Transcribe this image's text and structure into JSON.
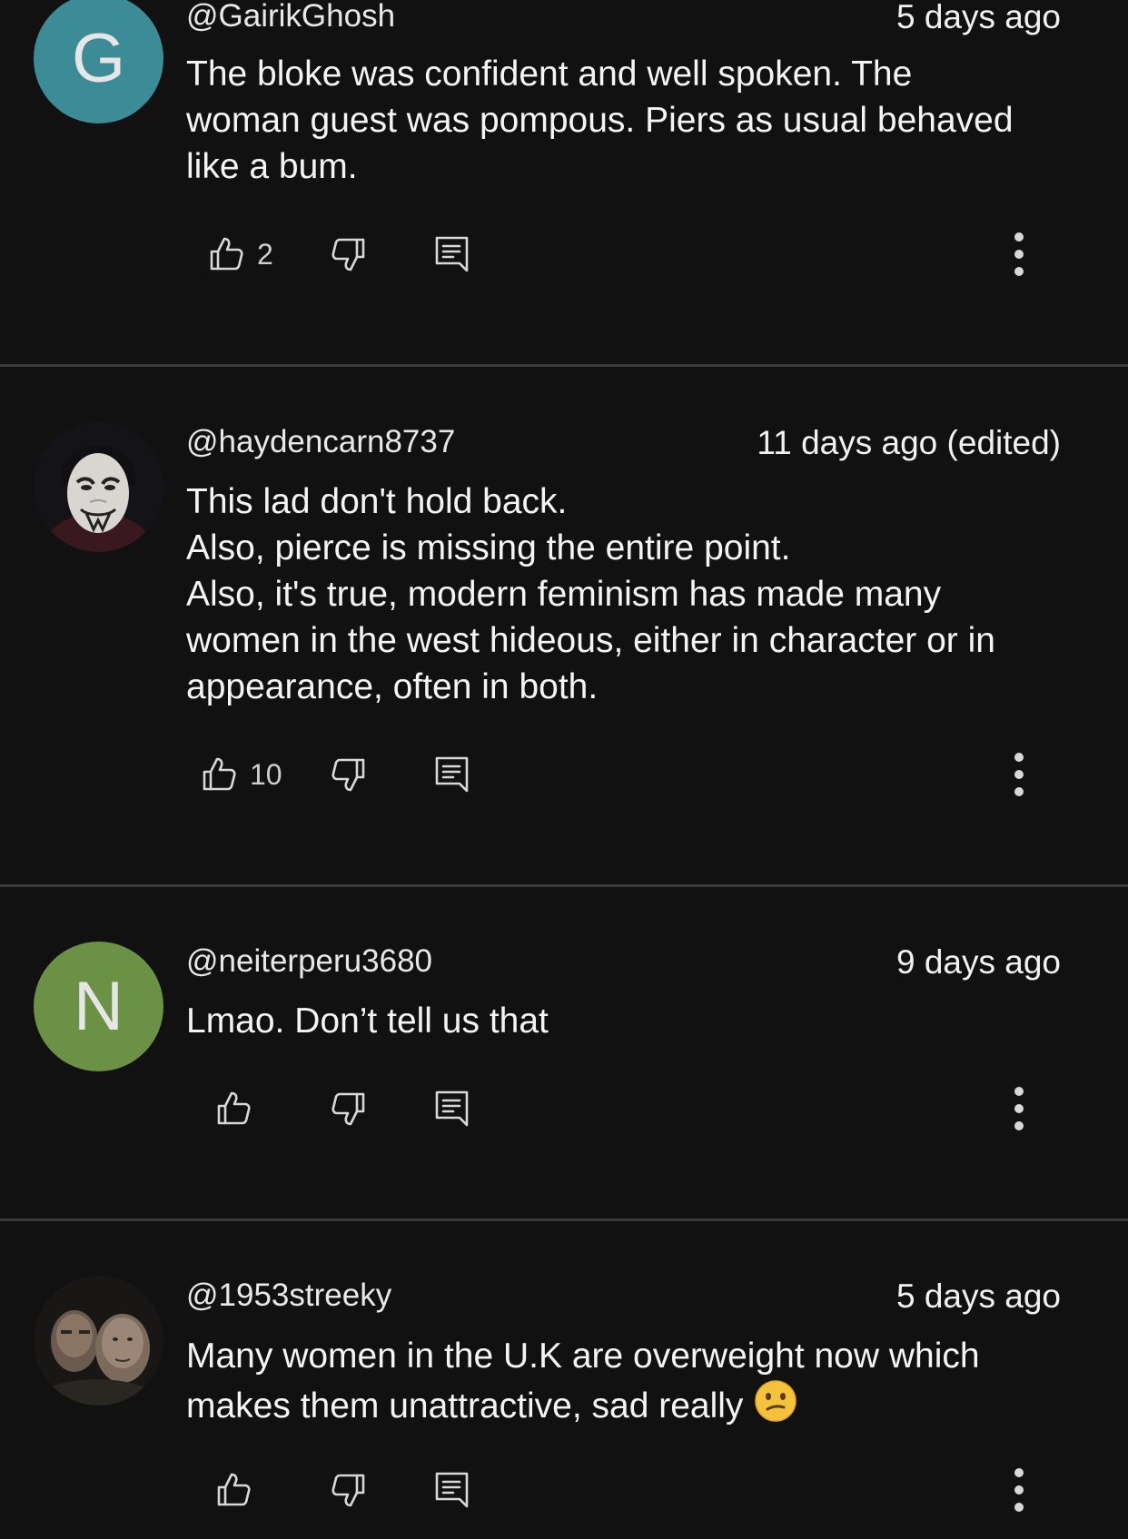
{
  "comments": [
    {
      "avatar_letter": "G",
      "avatar_color": "#3c8c97",
      "handle": "@GairikGhosh",
      "time": "5 days ago",
      "lines": [
        "The bloke was confident and well spoken. The",
        "woman guest was pompous. Piers as usual behaved",
        "like a bum."
      ],
      "likes": "2"
    },
    {
      "avatar_letter": "",
      "handle": "@haydencarn8737",
      "time": "11 days ago (edited)",
      "lines": [
        "This lad don't hold back.",
        "Also, pierce is missing the entire point.",
        "Also, it's true, modern feminism has made many",
        "women in the west hideous, either in character or in",
        "appearance, often in both."
      ],
      "likes": "10"
    },
    {
      "avatar_letter": "N",
      "avatar_color": "#6a9144",
      "handle": "@neiterperu3680",
      "time": "9 days ago",
      "lines": [
        "Lmao. Don’t tell us that"
      ],
      "likes": ""
    },
    {
      "avatar_letter": "",
      "handle": "@1953streeky",
      "time": "5 days ago",
      "lines": [
        "Many women in the U.K are overweight now which",
        "makes them unattractive, sad really"
      ],
      "emoji": "confused-face",
      "likes": ""
    }
  ],
  "icons": {
    "like": "thumb-up-icon",
    "dislike": "thumb-down-icon",
    "reply": "reply-comment-icon",
    "more": "more-vertical-icon"
  },
  "colors": {
    "background": "#111111",
    "divider": "#3a3a3a",
    "text": "#f1f1f1"
  }
}
